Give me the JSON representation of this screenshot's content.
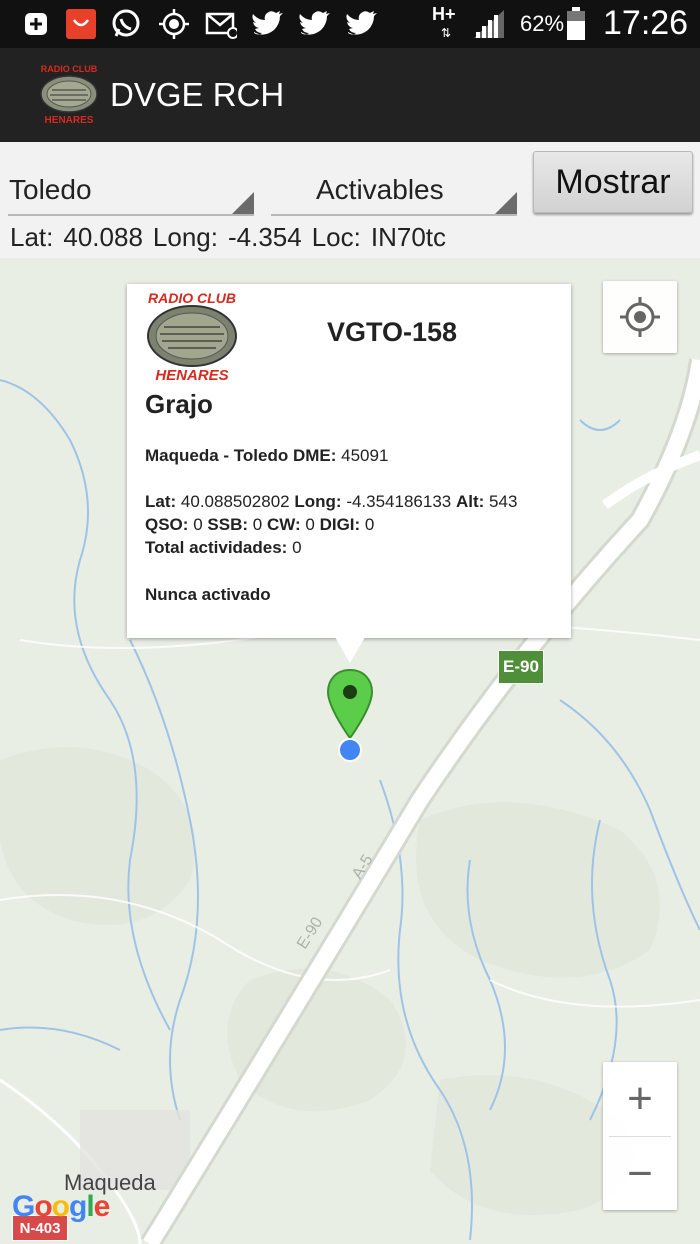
{
  "status_bar": {
    "icons": [
      "notification-plus-icon",
      "aliexpress-app-icon",
      "whatsapp-icon",
      "gps-icon",
      "email-icon",
      "twitter-icon",
      "twitter-icon",
      "twitter-icon"
    ],
    "network": "H+",
    "battery": "62%",
    "time": "17:26"
  },
  "app": {
    "title": "DVGE RCH",
    "logo_top_text": "RADIO CLUB",
    "logo_bottom_text": "HENARES"
  },
  "filters": {
    "province": "Toledo",
    "type": "Activables",
    "show_button": "Mostrar"
  },
  "location": {
    "lat_label": "Lat:",
    "lat_value": "40.088",
    "long_label": "Long:",
    "long_value": "-4.354",
    "loc_label": "Loc:",
    "loc_value": "IN70tc"
  },
  "popup": {
    "code": "VGTO-158",
    "name": "Grajo",
    "dme_label": "Maqueda - Toledo DME:",
    "dme_value": "45091",
    "lat_label": "Lat:",
    "lat_value": "40.088502802",
    "long_label": "Long:",
    "long_value": "-4.354186133",
    "alt_label": "Alt:",
    "alt_value": "543",
    "qso_label": "QSO:",
    "qso_value": "0",
    "ssb_label": "SSB:",
    "ssb_value": "0",
    "cw_label": "CW:",
    "cw_value": "0",
    "digi_label": "DIGI:",
    "digi_value": "0",
    "total_label": "Total actividades:",
    "total_value": "0",
    "status": "Nunca activado"
  },
  "map": {
    "road_shield": "E-90",
    "road_label": "E-90",
    "road_label2": "A-5",
    "place": "Maqueda",
    "road_n403": "N-403",
    "provider": "Google",
    "zoom_in": "+",
    "zoom_out": "−",
    "colors": {
      "land": "#e9eee5",
      "highway": "#ffffff",
      "water": "#9fc3e6",
      "marker": "#5ccd4a",
      "my_location": "#4286f4"
    }
  }
}
